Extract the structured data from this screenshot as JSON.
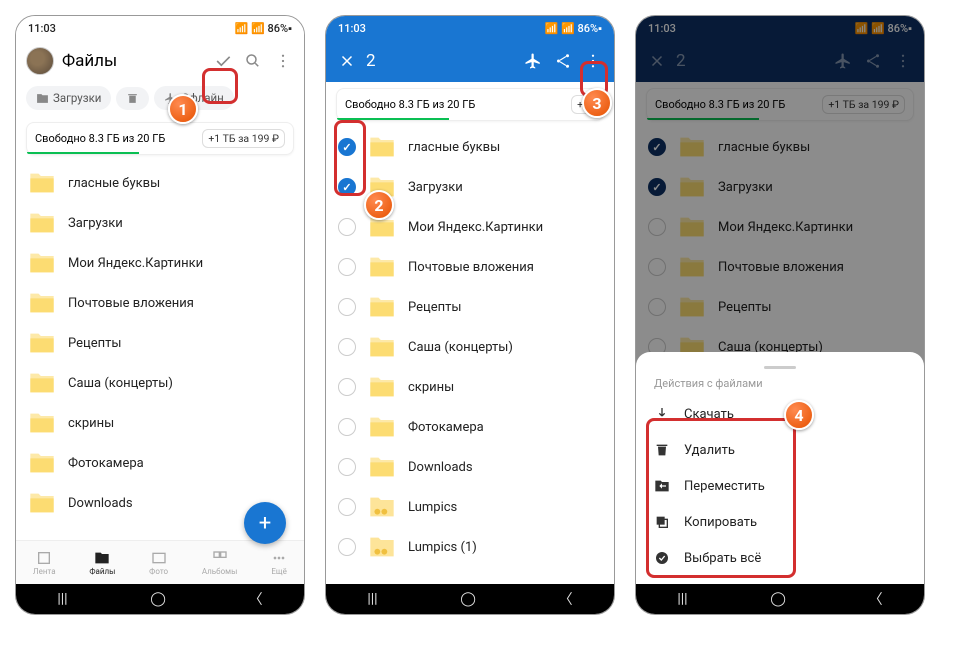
{
  "status": {
    "time": "11:03",
    "battery": "86%"
  },
  "screen1": {
    "title": "Файлы",
    "chips": {
      "downloads": "Загрузки",
      "trash": "",
      "offline": "Офлайн"
    },
    "storage": {
      "text": "Свободно 8.3 ГБ из 20 ГБ",
      "upsell": "+1 ТБ за 199 ₽"
    },
    "folders": [
      "гласные буквы",
      "Загрузки",
      "Мои Яндекс.Картинки",
      "Почтовые вложения",
      "Рецепты",
      "Саша (концерты)",
      "скрины",
      "Фотокамера",
      "Downloads"
    ],
    "nav": {
      "feed": "Лента",
      "files": "Файлы",
      "photo": "Фото",
      "albums": "Альбомы",
      "more": "Ещё"
    }
  },
  "screen2": {
    "count": "2",
    "storage": {
      "text": "Свободно 8.3 ГБ из 20 ГБ",
      "upsell": "+1 "
    },
    "folders": [
      {
        "label": "гласные буквы",
        "checked": true
      },
      {
        "label": "Загрузки",
        "checked": true
      },
      {
        "label": "Мои Яндекс.Картинки",
        "checked": false
      },
      {
        "label": "Почтовые вложения",
        "checked": false
      },
      {
        "label": "Рецепты",
        "checked": false
      },
      {
        "label": "Саша (концерты)",
        "checked": false
      },
      {
        "label": "скрины",
        "checked": false
      },
      {
        "label": "Фотокамера",
        "checked": false
      },
      {
        "label": "Downloads",
        "checked": false
      },
      {
        "label": "Lumpics",
        "checked": false
      },
      {
        "label": "Lumpics (1)",
        "checked": false
      }
    ]
  },
  "screen3": {
    "count": "2",
    "storage": {
      "text": "Свободно 8.3 ГБ из 20 ГБ",
      "upsell": "+1 ТБ за 199 ₽"
    },
    "folders": [
      {
        "label": "гласные буквы",
        "checked": true
      },
      {
        "label": "Загрузки",
        "checked": true
      },
      {
        "label": "Мои Яндекс.Картинки",
        "checked": false
      },
      {
        "label": "Почтовые вложения",
        "checked": false
      },
      {
        "label": "Рецепты",
        "checked": false
      },
      {
        "label": "Саша (концерты)",
        "checked": false
      }
    ],
    "sheet": {
      "title": "Действия с файлами",
      "download": "Скачать",
      "delete": "Удалить",
      "move": "Переместить",
      "copy": "Копировать",
      "select_all": "Выбрать всё"
    }
  },
  "badges": {
    "b1": "1",
    "b2": "2",
    "b3": "3",
    "b4": "4"
  }
}
